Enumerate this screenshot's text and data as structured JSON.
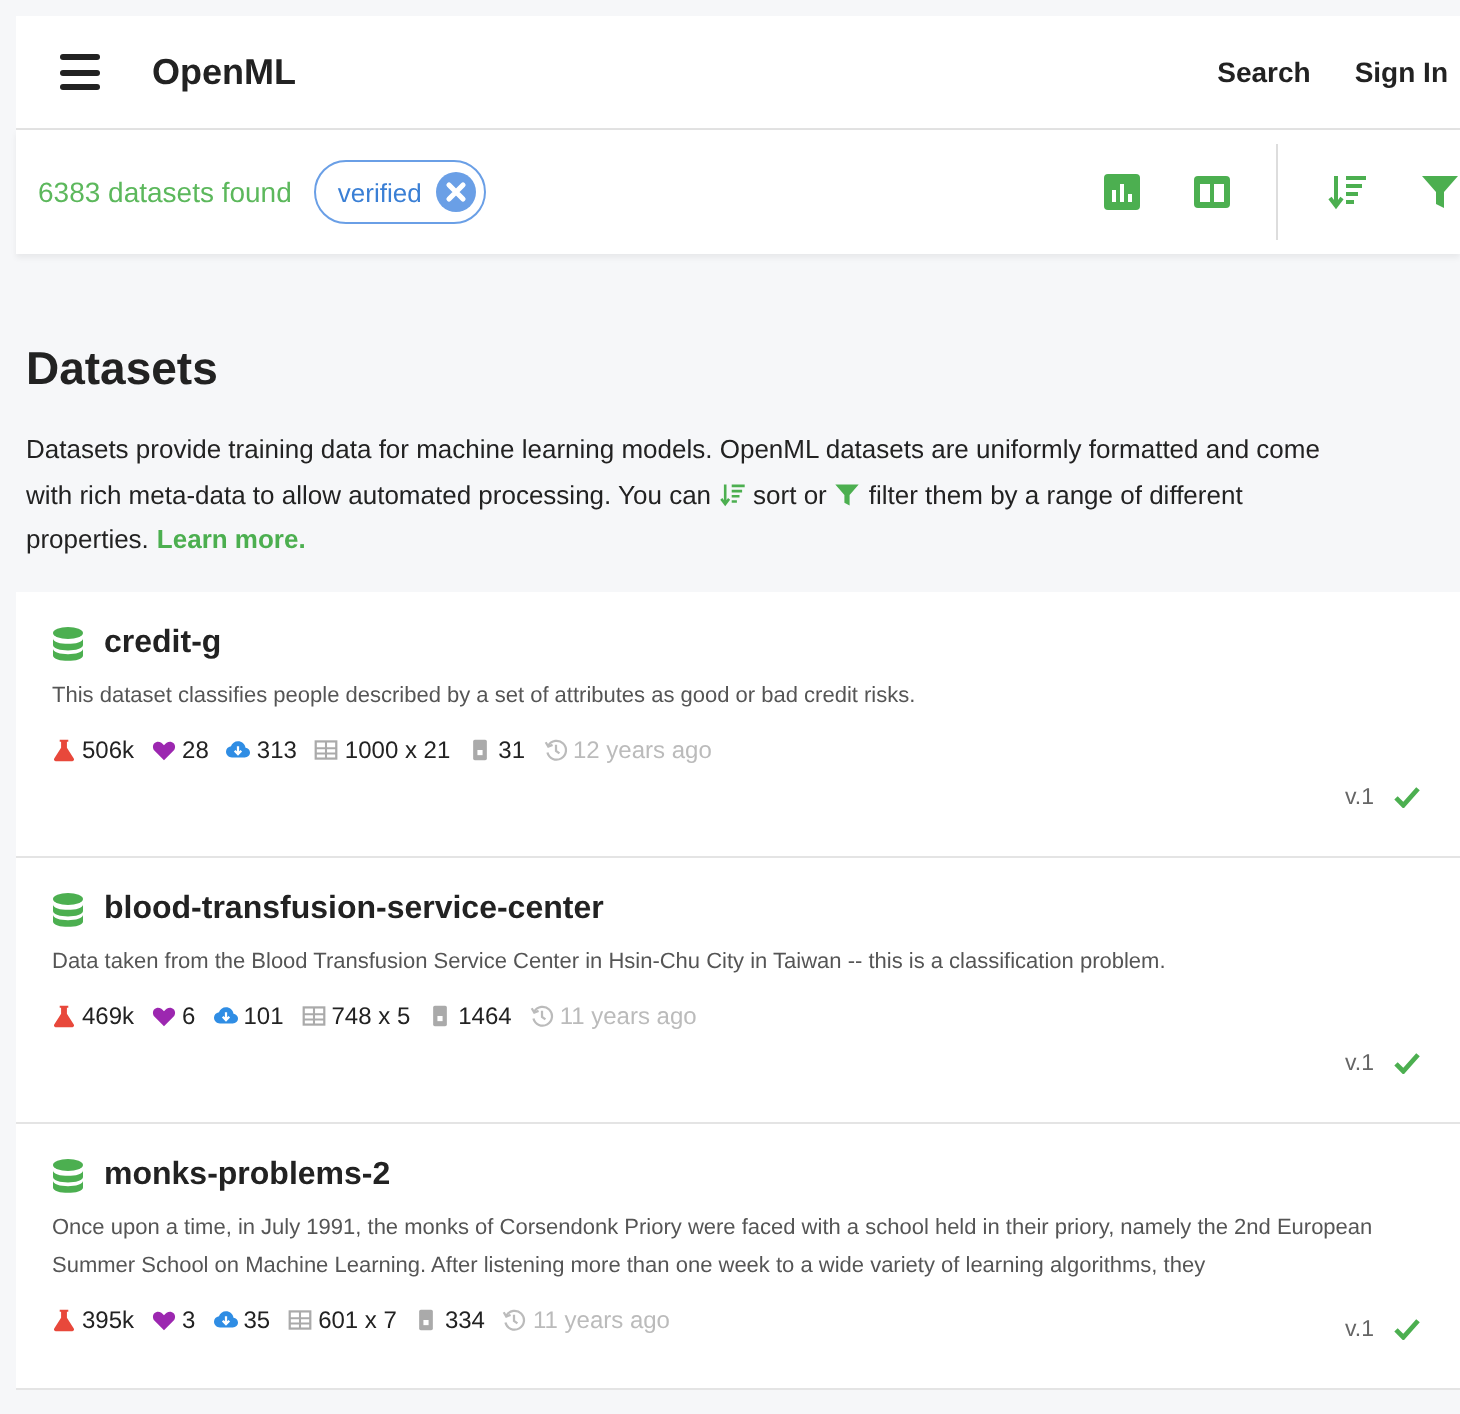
{
  "header": {
    "title": "OpenML",
    "links": [
      "Search",
      "Sign In"
    ]
  },
  "toolbar": {
    "count": "6383 datasets found",
    "filter_chip": "verified"
  },
  "heading": "Datasets",
  "intro": {
    "line_1": "Datasets provide training data for machine learning models. OpenML datasets are uniformly formatted and come",
    "line_2": "with rich meta-data to allow automated processing. You can",
    "between": "sort or",
    "after_filter": "filter them by a range of different",
    "line_3": "properties.",
    "link": "Learn more."
  },
  "datasets": [
    {
      "name": "credit-g",
      "description": "This dataset classifies people described by a set of attributes as good or bad credit risks.",
      "runs": "506k",
      "likes": "28",
      "downloads": "313",
      "dimensions": "1000 x 21",
      "tasks": "31",
      "age": "12 years ago",
      "version": "v.1",
      "verified": true
    },
    {
      "name": "blood-transfusion-service-center",
      "description": "Data taken from the Blood Transfusion Service Center in Hsin-Chu City in Taiwan -- this is a classification problem.",
      "runs": "469k",
      "likes": "6",
      "downloads": "101",
      "dimensions": "748 x 5",
      "tasks": "1464",
      "age": "11 years ago",
      "version": "v.1",
      "verified": true
    },
    {
      "name": "monks-problems-2",
      "description": "Once upon a time, in July 1991, the monks of Corsendonk Priory were faced with a school held in their priory, namely the 2nd European Summer School on Machine Learning. After listening more than one week to a wide variety of learning algorithms, they",
      "runs": "395k",
      "likes": "3",
      "downloads": "35",
      "dimensions": "601 x 7",
      "tasks": "334",
      "age": "11 years ago",
      "version": "v.1",
      "verified": true
    }
  ]
}
